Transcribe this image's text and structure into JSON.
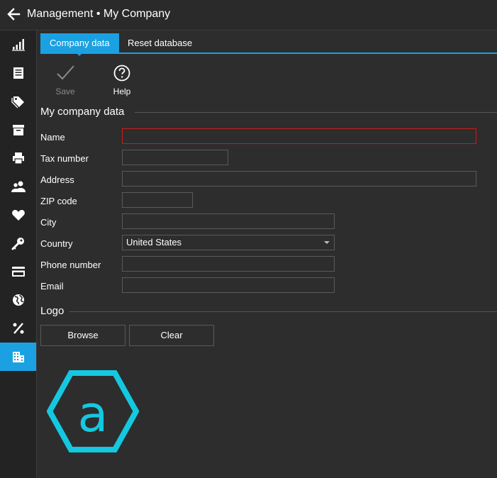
{
  "window": {
    "title": "Management • My Company"
  },
  "sidebar": {
    "items": [
      {
        "icon": "bar-chart-icon"
      },
      {
        "icon": "receipt-icon"
      },
      {
        "icon": "tags-icon"
      },
      {
        "icon": "archive-icon"
      },
      {
        "icon": "printer-icon"
      },
      {
        "icon": "users-icon"
      },
      {
        "icon": "heart-icon"
      },
      {
        "icon": "key-icon"
      },
      {
        "icon": "credit-card-icon"
      },
      {
        "icon": "globe-icon"
      },
      {
        "icon": "percent-icon"
      },
      {
        "icon": "building-icon",
        "active": true
      }
    ]
  },
  "tabs": [
    {
      "label": "Company data",
      "active": true
    },
    {
      "label": "Reset database",
      "active": false
    }
  ],
  "toolbar": {
    "save_label": "Save",
    "help_label": "Help"
  },
  "company": {
    "section_title": "My company data",
    "fields": {
      "name": {
        "label": "Name",
        "value": ""
      },
      "tax_number": {
        "label": "Tax number",
        "value": ""
      },
      "address": {
        "label": "Address",
        "value": ""
      },
      "zip": {
        "label": "ZIP code",
        "value": ""
      },
      "city": {
        "label": "City",
        "value": ""
      },
      "country": {
        "label": "Country",
        "value": "United States"
      },
      "phone": {
        "label": "Phone number",
        "value": ""
      },
      "email": {
        "label": "Email",
        "value": ""
      }
    }
  },
  "logo_section": {
    "title": "Logo",
    "browse_label": "Browse",
    "clear_label": "Clear",
    "logo_letter": "a"
  },
  "colors": {
    "accent": "#1ba1e2",
    "logo": "#14c8e0",
    "error": "#d01a1a"
  }
}
